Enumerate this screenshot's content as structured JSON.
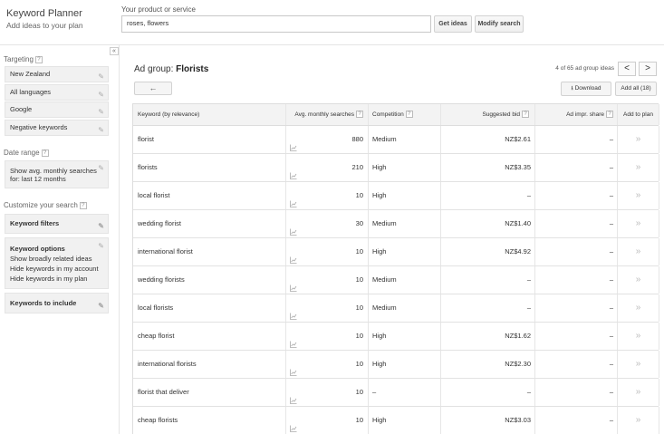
{
  "header": {
    "title": "Keyword Planner",
    "subtitle": "Add ideas to your plan",
    "product_label": "Your product or service",
    "product_value": "roses, flowers",
    "get_ideas": "Get ideas",
    "modify_search": "Modify search"
  },
  "sidebar": {
    "collapse": "«",
    "targeting_label": "Targeting",
    "targeting": [
      "New Zealand",
      "All languages",
      "Google",
      "Negative keywords"
    ],
    "date_range_label": "Date range",
    "date_range_line1": "Show avg. monthly searches",
    "date_range_line2": "for: last 12 months",
    "customize_label": "Customize your search",
    "keyword_filters": "Keyword filters",
    "keyword_options_title": "Keyword options",
    "keyword_options": [
      "Show broadly related ideas",
      "Hide keywords in my account",
      "Hide keywords in my plan"
    ],
    "keywords_to_include": "Keywords to include"
  },
  "main": {
    "adgroup_prefix": "Ad group:",
    "adgroup_name": "Florists",
    "back": "←",
    "pager_text": "4 of 65 ad group ideas",
    "prev": "<",
    "next": ">",
    "download": "Download",
    "add_all": "Add all (18)"
  },
  "table": {
    "headers": {
      "keyword": "Keyword (by relevance)",
      "avg": "Avg. monthly searches",
      "competition": "Competition",
      "bid": "Suggested bid",
      "share": "Ad impr. share",
      "add": "Add to plan"
    },
    "rows": [
      {
        "keyword": "florist",
        "avg": "880",
        "competition": "Medium",
        "bid": "NZ$2.61",
        "share": "–",
        "add": "»"
      },
      {
        "keyword": "florists",
        "avg": "210",
        "competition": "High",
        "bid": "NZ$3.35",
        "share": "–",
        "add": "»"
      },
      {
        "keyword": "local florist",
        "avg": "10",
        "competition": "High",
        "bid": "–",
        "share": "–",
        "add": "»"
      },
      {
        "keyword": "wedding florist",
        "avg": "30",
        "competition": "Medium",
        "bid": "NZ$1.40",
        "share": "–",
        "add": "»"
      },
      {
        "keyword": "international florist",
        "avg": "10",
        "competition": "High",
        "bid": "NZ$4.92",
        "share": "–",
        "add": "»"
      },
      {
        "keyword": "wedding florists",
        "avg": "10",
        "competition": "Medium",
        "bid": "–",
        "share": "–",
        "add": "»"
      },
      {
        "keyword": "local florists",
        "avg": "10",
        "competition": "Medium",
        "bid": "–",
        "share": "–",
        "add": "»"
      },
      {
        "keyword": "cheap florist",
        "avg": "10",
        "competition": "High",
        "bid": "NZ$1.62",
        "share": "–",
        "add": "»"
      },
      {
        "keyword": "international florists",
        "avg": "10",
        "competition": "High",
        "bid": "NZ$2.30",
        "share": "–",
        "add": "»"
      },
      {
        "keyword": "florist that deliver",
        "avg": "10",
        "competition": "–",
        "bid": "–",
        "share": "–",
        "add": "»"
      },
      {
        "keyword": "cheap florists",
        "avg": "10",
        "competition": "High",
        "bid": "NZ$3.03",
        "share": "–",
        "add": "»"
      }
    ]
  }
}
